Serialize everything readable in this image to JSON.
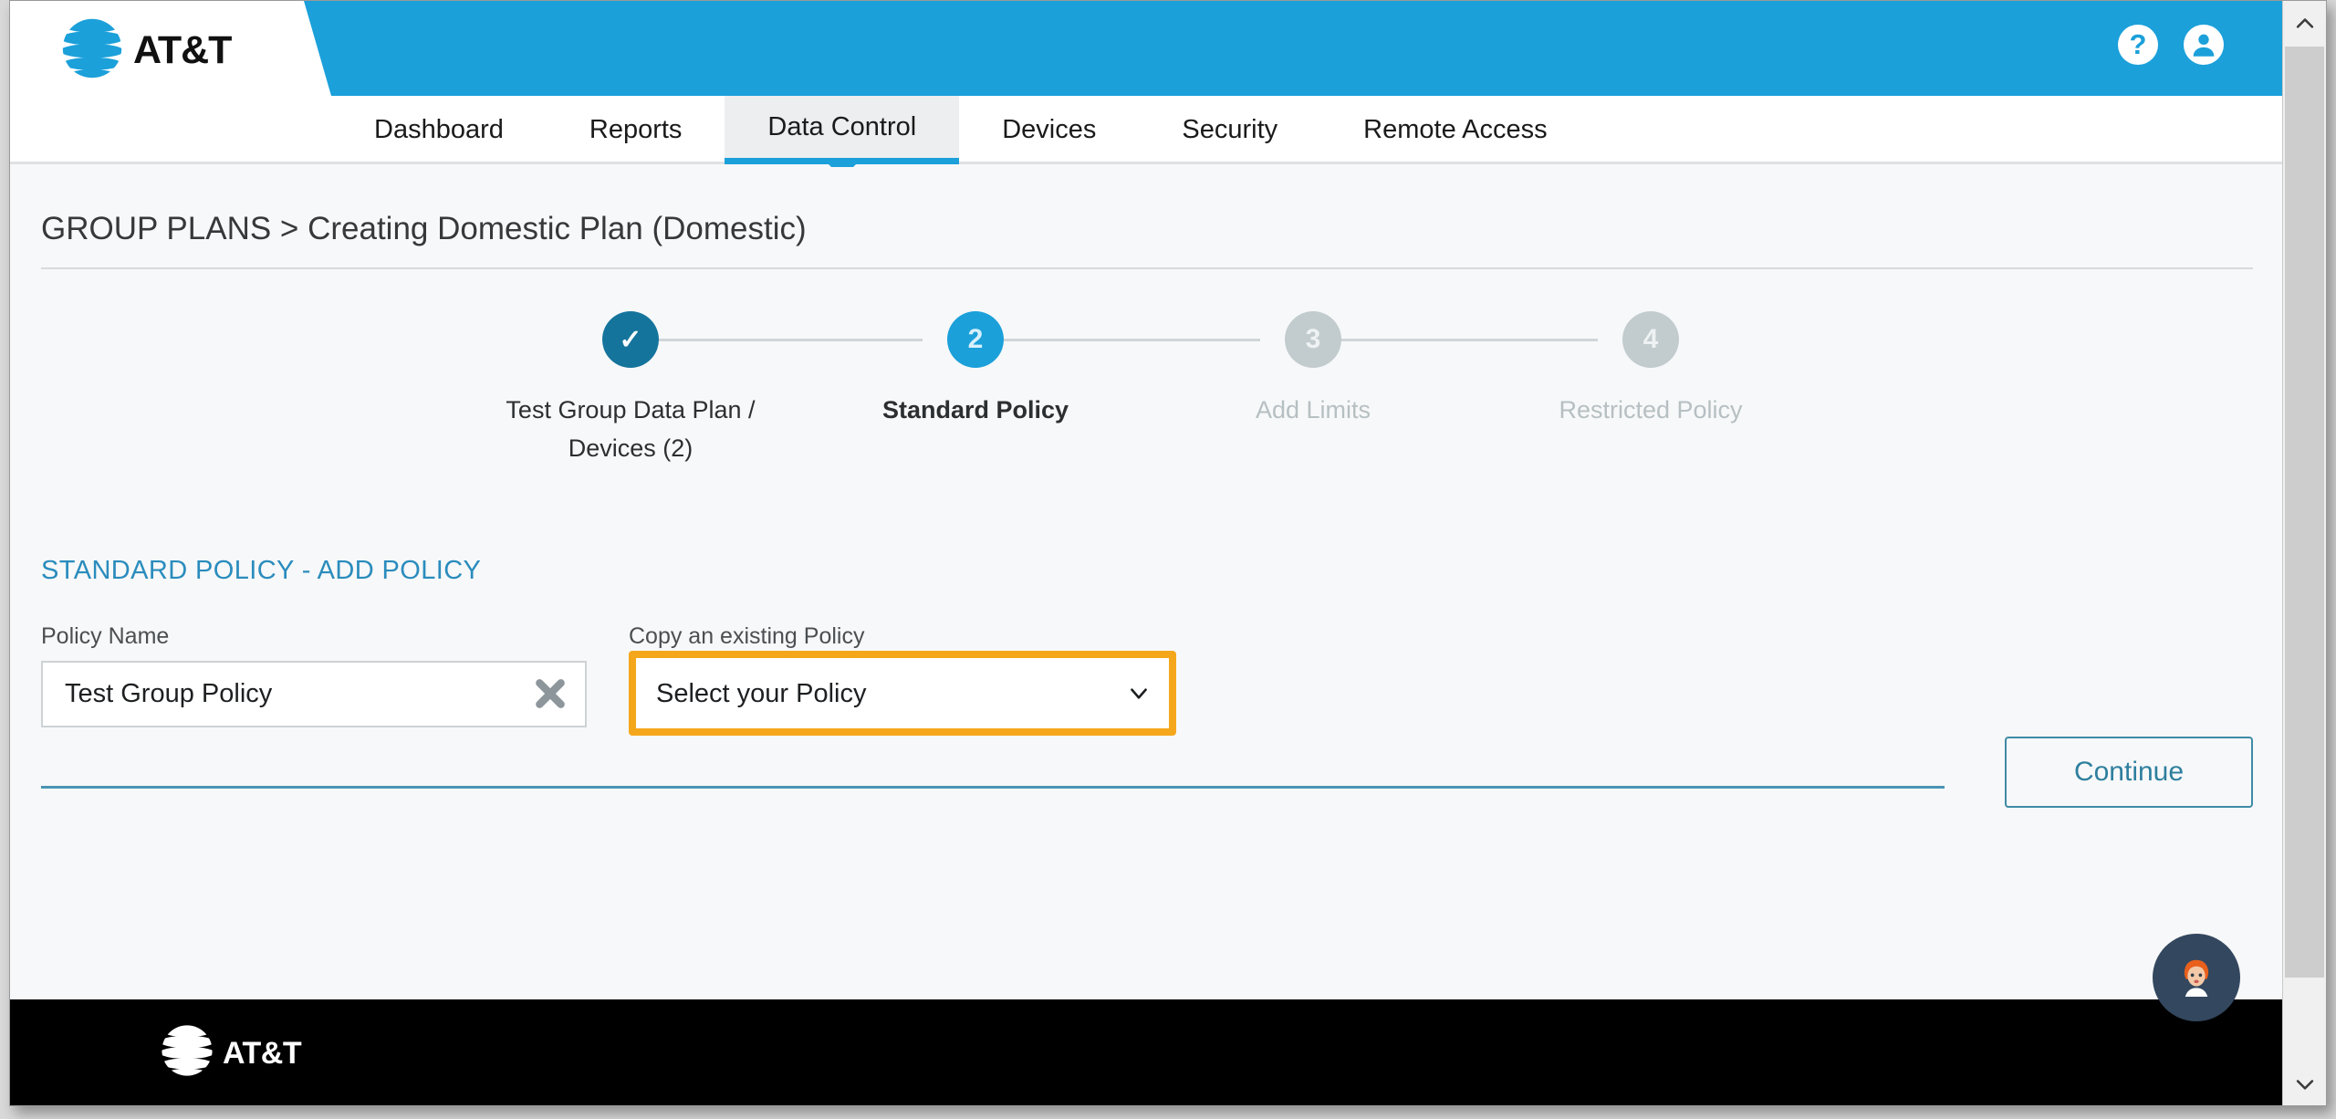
{
  "brand": {
    "name": "AT&T",
    "accent_blue": "#1ba0da",
    "dark_blue": "#15749c",
    "highlight_orange": "#f5a71c",
    "footer_bg": "#000000"
  },
  "topbar": {
    "help_icon": "help-question-icon",
    "help_glyph": "?",
    "account_icon": "user-account-icon"
  },
  "nav": {
    "items": [
      {
        "label": "Dashboard",
        "active": false
      },
      {
        "label": "Reports",
        "active": false
      },
      {
        "label": "Data Control",
        "active": true
      },
      {
        "label": "Devices",
        "active": false
      },
      {
        "label": "Security",
        "active": false
      },
      {
        "label": "Remote Access",
        "active": false
      }
    ]
  },
  "breadcrumb": {
    "text": "GROUP PLANS > Creating Domestic Plan (Domestic)"
  },
  "stepper": {
    "steps": [
      {
        "marker": "✓",
        "label": "Test Group Data Plan / Devices (2)",
        "state": "done"
      },
      {
        "marker": "2",
        "label": "Standard Policy",
        "state": "active"
      },
      {
        "marker": "3",
        "label": "Add Limits",
        "state": "todo"
      },
      {
        "marker": "4",
        "label": "Restricted Policy",
        "state": "todo"
      }
    ]
  },
  "form": {
    "section_title": "STANDARD POLICY - ADD POLICY",
    "policy_name": {
      "label": "Policy Name",
      "value": "Test Group Policy",
      "placeholder": "Policy Name",
      "clear_icon": "clear-x-icon"
    },
    "copy_policy": {
      "label": "Copy an existing Policy",
      "selected": "Select your Policy",
      "options": [
        "Select your Policy"
      ],
      "caret_icon": "chevron-down-icon",
      "highlighted": true
    },
    "continue_label": "Continue"
  },
  "chat": {
    "icon": "chat-assistant-avatar-icon"
  },
  "footer": {
    "brand": "AT&T"
  },
  "scrollbar": {
    "up_icon": "chevron-up-icon",
    "down_icon": "chevron-down-icon"
  }
}
